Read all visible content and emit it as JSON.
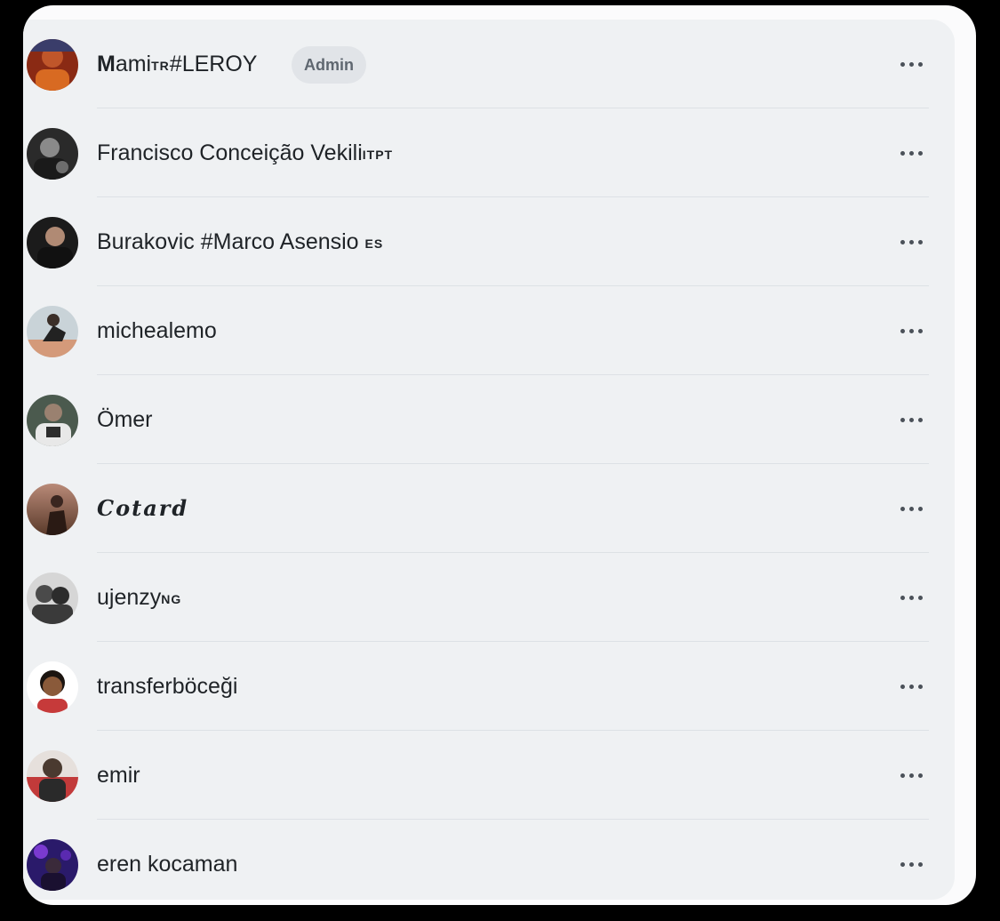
{
  "members": [
    {
      "name_main": "M",
      "name_rest": "ami",
      "name_tag": "TR",
      "name_tail": "#LEROY",
      "badge": "Admin",
      "avatar_icon": "avatar-photo-orange"
    },
    {
      "name": "Francisco Conceição Vekili",
      "name_tag": "ITPT",
      "avatar_icon": "avatar-photo-dark"
    },
    {
      "name": "Burakovic #Marco Asensio ",
      "name_tag": "ES",
      "avatar_icon": "avatar-photo-dark"
    },
    {
      "name": "michealemo",
      "avatar_icon": "avatar-photo-light"
    },
    {
      "name": "Ömer",
      "avatar_icon": "avatar-photo-green"
    },
    {
      "name": "Cotard",
      "avatar_icon": "avatar-photo-sunset"
    },
    {
      "name": "ujenzy",
      "name_tag": "NG",
      "avatar_icon": "avatar-photo-grey"
    },
    {
      "name": "transferböceği",
      "avatar_icon": "avatar-photo-white"
    },
    {
      "name": "emir",
      "avatar_icon": "avatar-photo-red"
    },
    {
      "name": "eren kocaman",
      "avatar_icon": "avatar-photo-purple"
    }
  ],
  "more_icon": "more-horizontal-icon"
}
